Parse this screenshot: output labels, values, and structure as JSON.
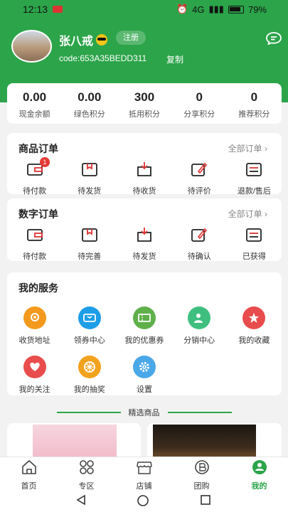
{
  "status_bar": {
    "time": "12:13",
    "network": "4G",
    "battery": "79%"
  },
  "profile": {
    "username": "张八戒",
    "register_label": "注册",
    "code": "code:653A35BEDD311",
    "copy_label": "复制"
  },
  "stats": [
    {
      "value": "0.00",
      "label": "现金余额"
    },
    {
      "value": "0.00",
      "label": "绿色积分"
    },
    {
      "value": "300",
      "label": "抵用积分"
    },
    {
      "value": "0",
      "label": "分享积分"
    },
    {
      "value": "0",
      "label": "推荐积分"
    }
  ],
  "goods_orders": {
    "title": "商品订单",
    "more": "全部订单 ›",
    "items": [
      {
        "label": "待付款",
        "badge": "1",
        "icon": "wallet-icon"
      },
      {
        "label": "待发货",
        "icon": "package-icon"
      },
      {
        "label": "待收货",
        "icon": "inbox-download-icon"
      },
      {
        "label": "待评价",
        "icon": "edit-comment-icon"
      },
      {
        "label": "退款/售后",
        "icon": "refund-list-icon"
      }
    ]
  },
  "digital_orders": {
    "title": "数字订单",
    "more": "全部订单 ›",
    "items": [
      {
        "label": "待付款",
        "icon": "wallet-icon"
      },
      {
        "label": "待完善",
        "icon": "package-icon"
      },
      {
        "label": "待发货",
        "icon": "inbox-download-icon"
      },
      {
        "label": "待确认",
        "icon": "edit-comment-icon"
      },
      {
        "label": "已获得",
        "icon": "list-icon"
      }
    ]
  },
  "services": {
    "title": "我的服务",
    "items": [
      {
        "label": "收货地址",
        "icon": "location-icon",
        "color": "#f39a1e"
      },
      {
        "label": "领券中心",
        "icon": "ticket-icon",
        "color": "#1e9ee8"
      },
      {
        "label": "我的优惠券",
        "icon": "coupon-icon",
        "color": "#5fb04a"
      },
      {
        "label": "分销中心",
        "icon": "user-share-icon",
        "color": "#3fbf7f"
      },
      {
        "label": "我的收藏",
        "icon": "star-icon",
        "color": "#e84c4c"
      },
      {
        "label": "我的关注",
        "icon": "heart-icon",
        "color": "#e84c4c"
      },
      {
        "label": "我的抽奖",
        "icon": "lottery-wheel-icon",
        "color": "#f3a21e"
      },
      {
        "label": "设置",
        "icon": "settings-icon",
        "color": "#4aa8e8"
      }
    ]
  },
  "featured": {
    "title": "精选商品"
  },
  "tabbar": [
    {
      "label": "首页",
      "icon": "home-icon"
    },
    {
      "label": "专区",
      "icon": "grid-icon"
    },
    {
      "label": "店铺",
      "icon": "store-icon"
    },
    {
      "label": "团购",
      "icon": "group-buy-icon"
    },
    {
      "label": "我的",
      "icon": "profile-icon",
      "active": true
    }
  ],
  "colors": {
    "brand": "#2ca44a",
    "badge": "#e53935"
  }
}
